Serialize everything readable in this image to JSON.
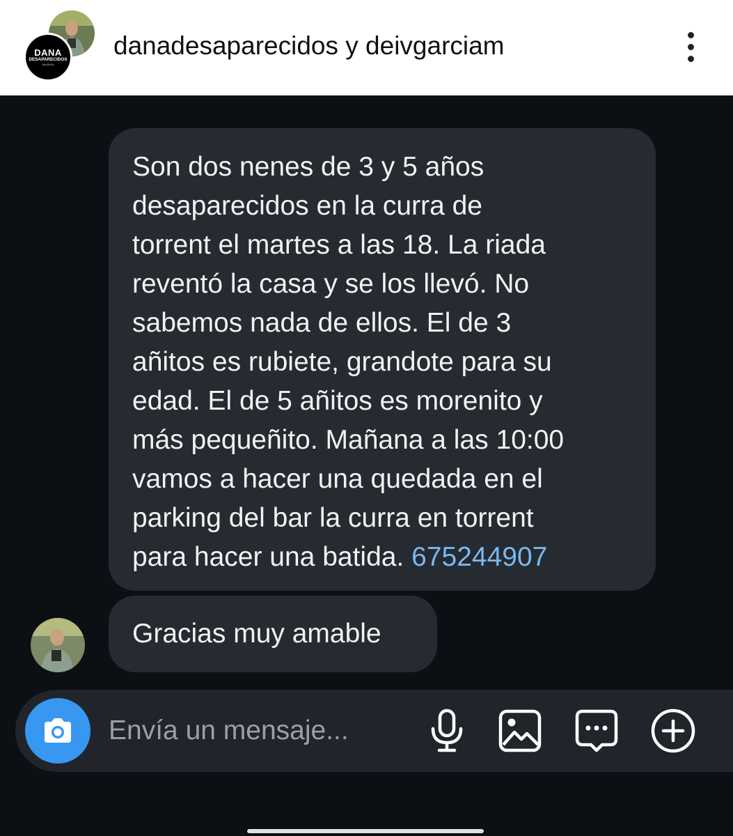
{
  "header": {
    "title": "danadesaparecidos y deivgarciam",
    "group_logo": {
      "line1": "DANA",
      "line2": "DESAPARECIDOS",
      "line3": "VALENCIA"
    },
    "more_icon": "more-vertical-icon"
  },
  "messages": [
    {
      "text": "Son dos nenes de 3 y 5 años\ndesaparecidos en la curra de\ntorrent el martes a las 18. La riada\nreventó la casa y se los llevó. No\nsabemos nada de ellos. El de 3\nañitos es rubiete, grandote para su\nedad. El de 5 añitos es morenito y\nmás pequeñito. Mañana a las 10:00\nvamos a hacer una quedada en el\nparking del bar la curra  en torrent\npara hacer una batida. ",
      "phone": "675244907"
    },
    {
      "text": "Gracias muy amable"
    }
  ],
  "composer": {
    "placeholder": "Envía un mensaje...",
    "icons": [
      "camera-icon",
      "microphone-icon",
      "gallery-icon",
      "sticker-icon",
      "plus-icon"
    ]
  },
  "colors": {
    "background": "#0c0f14",
    "bubble": "#262a31",
    "link": "#7ab8ee",
    "camera_button": "#3897f0"
  }
}
